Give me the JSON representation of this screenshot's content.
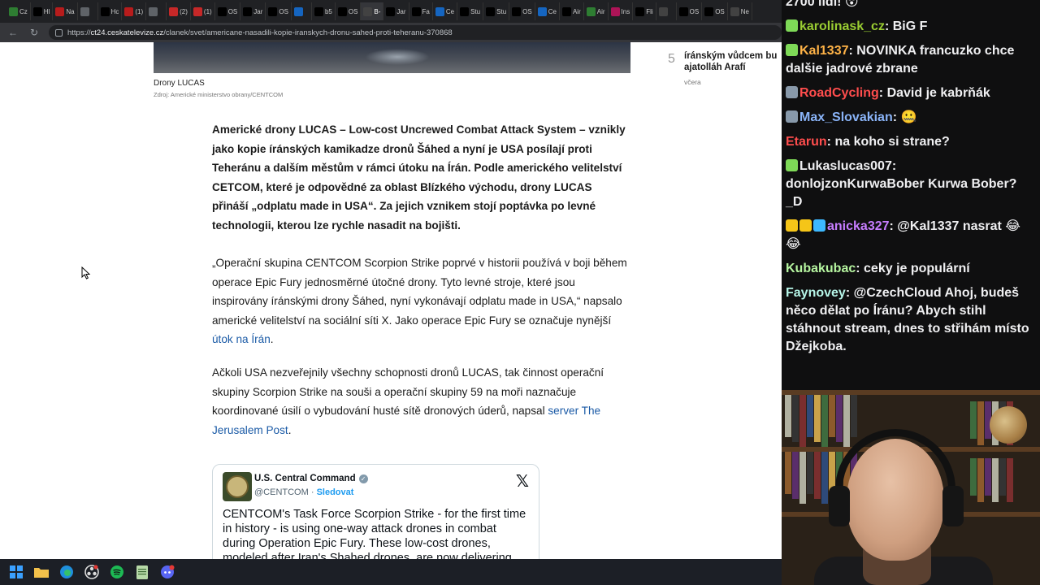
{
  "browser": {
    "tabs": [
      {
        "label": "Cz",
        "color": "#2e7d32"
      },
      {
        "label": "Hl",
        "color": "#000000"
      },
      {
        "label": "Na",
        "color": "#b71c1c"
      },
      {
        "label": "",
        "color": "#5f6368"
      },
      {
        "label": "Hc",
        "color": "#000000"
      },
      {
        "label": "(1)",
        "color": "#b71c1c"
      },
      {
        "label": "",
        "color": "#5f6368"
      },
      {
        "label": "(2)",
        "color": "#c62828"
      },
      {
        "label": "(1)",
        "color": "#c62828"
      },
      {
        "label": "OS",
        "color": "#000000"
      },
      {
        "label": "Jar",
        "color": "#000000"
      },
      {
        "label": "OS",
        "color": "#000000"
      },
      {
        "label": "",
        "color": "#1565c0"
      },
      {
        "label": "b5",
        "color": "#000000"
      },
      {
        "label": "OS",
        "color": "#000000"
      },
      {
        "label": "B-",
        "color": "#424242"
      },
      {
        "label": "Jar",
        "color": "#000000"
      },
      {
        "label": "Fa",
        "color": "#000000"
      },
      {
        "label": "Ce",
        "color": "#1565c0"
      },
      {
        "label": "Stu",
        "color": "#000000"
      },
      {
        "label": "Stu",
        "color": "#000000"
      },
      {
        "label": "OS",
        "color": "#000000"
      },
      {
        "label": "Ce",
        "color": "#1565c0"
      },
      {
        "label": "Air",
        "color": "#000000"
      },
      {
        "label": "Air",
        "color": "#2e7d32"
      },
      {
        "label": "Ins",
        "color": "#ad1457"
      },
      {
        "label": "Fli",
        "color": "#000000"
      },
      {
        "label": "",
        "color": "#424242"
      },
      {
        "label": "OS",
        "color": "#000000"
      },
      {
        "label": "OS",
        "color": "#000000"
      },
      {
        "label": "Ne",
        "color": "#424242"
      }
    ],
    "url_prefix": "https://",
    "url_host": "ct24.ceskatelevize.cz",
    "url_path": "/clanek/svet/americane-nasadili-kopie-iranskych-dronu-sahed-proti-teheranu-370868"
  },
  "article": {
    "caption": "Drony LUCAS",
    "source": "Zdroj: Americké ministerstvo obrany/CENTCOM",
    "lead": "Americké drony LUCAS – Low-cost Uncrewed Combat Attack System – vznikly jako kopie íránských kamikadze dronů Šáhed a nyní je USA posílají proti Teheránu a dalším městům v rámci útoku na Írán. Podle amerického velitelství CETCOM, které je odpovědné za oblast Blízkého východu, drony LUCAS přináší „odplatu made in USA“. Za jejich vznikem stojí poptávka po levné technologii, kterou lze rychle nasadit na bojišti.",
    "para1_text": "„Operační skupina CENTCOM Scorpion Strike poprvé v historii používá v boji během operace Epic Fury jednosměrné útočné drony. Tyto levné stroje, které jsou inspirovány íránskými drony Šáhed, nyní vykonávají odplatu made in USA,“ napsalo americké velitelství na sociální síti X. Jako operace Epic Fury se označuje nynější ",
    "para1_link": "útok na Írán",
    "para1_end": ".",
    "para2_text": "Ačkoli USA nezveřejnily všechny schopnosti dronů LUCAS, tak činnost operační skupiny Scorpion Strike na souši a operační skupiny 59 na moři naznačuje koordinované úsilí o vybudování husté sítě dronových úderů, napsal ",
    "para2_link": "server The Jerusalem Post",
    "para2_end": "."
  },
  "tweet": {
    "name": "U.S. Central Command",
    "handle": "@CENTCOM",
    "separator": "·",
    "follow": "Sledovat",
    "text": "CENTCOM's Task Force Scorpion Strike - for the first time in history - is using one-way attack drones in combat during Operation Epic Fury. These low-cost drones, modeled after Iran's Shahed drones, are now delivering"
  },
  "trending": {
    "number": "5",
    "title_line1": "íránským vůdcem bu",
    "title_line2": "ajatolláh Arafí",
    "time": "včera"
  },
  "chat": [
    {
      "user": "",
      "user_color": "#efeff1",
      "text": "2700 lidí! 😲",
      "badges": [],
      "partial": true
    },
    {
      "user": "karolinask_cz",
      "user_color": "#9acd32",
      "text": "BiG F",
      "badges": [
        "#7ed957"
      ]
    },
    {
      "user": "Kal1337",
      "user_color": "#ffb347",
      "text": "NOVINKA francuzko chce dalšie jadrové zbrane",
      "badges": [
        "#7ed957"
      ]
    },
    {
      "user": "RoadCycling",
      "user_color": "#ff4d4d",
      "text": "David je kabrňák",
      "badges": [
        "#8899aa"
      ]
    },
    {
      "user": "Max_Slovakian",
      "user_color": "#8ab4f8",
      "text": "🤐",
      "badges": [
        "#8899aa"
      ]
    },
    {
      "user": "Etarun",
      "user_color": "#ff4d4d",
      "text": "na koho si strane?",
      "badges": []
    },
    {
      "user": "Lukaslucas007",
      "user_color": "#efeff1",
      "text": "donlojzonKurwaBober Kurwa Bober? _D",
      "badges": [
        "#7ed957"
      ]
    },
    {
      "user": "anicka327",
      "user_color": "#c77dff",
      "text": "@Kal1337 nasrat 😂 😂",
      "badges": [
        "#f5c518",
        "#f5c518",
        "#3db8ff"
      ]
    },
    {
      "user": "Kubakubac",
      "user_color": "#b6f5a0",
      "text": "ceky je populární",
      "badges": []
    },
    {
      "user": "Faynovey",
      "user_color": "#b6f5e8",
      "text": "@CzechCloud Ahoj, budeš něco dělat po Íránu? Abych stihl stáhnout stream, dnes to střihám místo Džejkoba.",
      "badges": []
    }
  ]
}
